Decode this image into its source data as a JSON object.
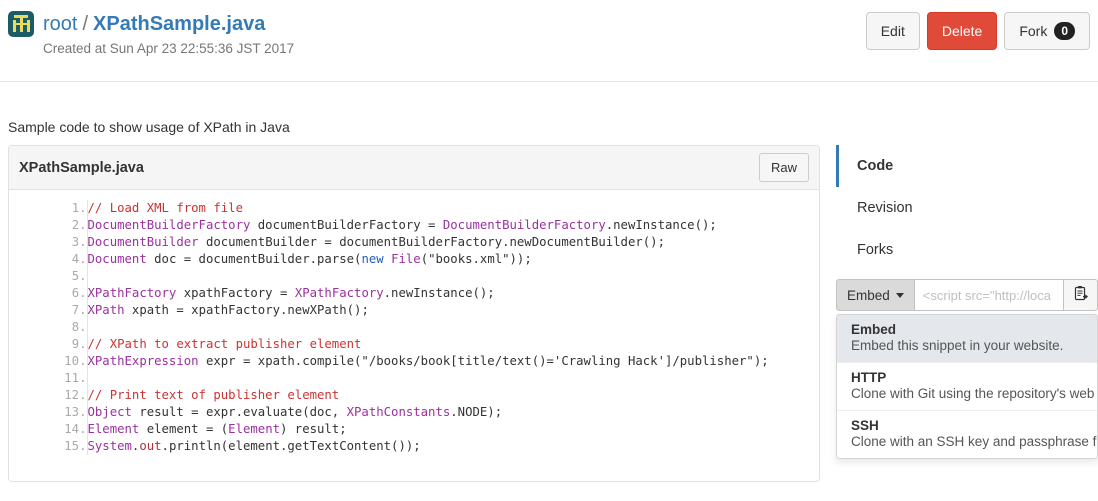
{
  "header": {
    "owner": "root",
    "separator": "/",
    "filename": "XPathSample.java",
    "created_at": "Created at Sun Apr 23 22:55:36 JST 2017",
    "avatar_icon": "identicon-avatar",
    "actions": {
      "edit_label": "Edit",
      "delete_label": "Delete",
      "fork_label": "Fork",
      "fork_count": "0"
    }
  },
  "main": {
    "description": "Sample code to show usage of XPath in Java",
    "code_panel": {
      "filename": "XPathSample.java",
      "raw_label": "Raw",
      "language": "java",
      "lines": [
        {
          "n": "1.",
          "tokens": [
            {
              "t": "// Load XML from file",
              "c": "c-com"
            }
          ]
        },
        {
          "n": "2.",
          "tokens": [
            {
              "t": "DocumentBuilderFactory",
              "c": "c-type"
            },
            {
              "t": " documentBuilderFactory = ",
              "c": "c-pln"
            },
            {
              "t": "DocumentBuilderFactory",
              "c": "c-type"
            },
            {
              "t": ".newInstance();",
              "c": "c-pln"
            }
          ]
        },
        {
          "n": "3.",
          "tokens": [
            {
              "t": "DocumentBuilder",
              "c": "c-type"
            },
            {
              "t": " documentBuilder = documentBuilderFactory.newDocumentBuilder();",
              "c": "c-pln"
            }
          ]
        },
        {
          "n": "4.",
          "tokens": [
            {
              "t": "Document",
              "c": "c-type"
            },
            {
              "t": " doc = documentBuilder.parse(",
              "c": "c-pln"
            },
            {
              "t": "new",
              "c": "c-kw"
            },
            {
              "t": " ",
              "c": "c-pln"
            },
            {
              "t": "File",
              "c": "c-type"
            },
            {
              "t": "(\"books.xml\"));",
              "c": "c-pln"
            }
          ]
        },
        {
          "n": "5.",
          "tokens": [
            {
              "t": "",
              "c": "c-pln"
            }
          ]
        },
        {
          "n": "6.",
          "tokens": [
            {
              "t": "XPathFactory",
              "c": "c-type"
            },
            {
              "t": " xpathFactory = ",
              "c": "c-pln"
            },
            {
              "t": "XPathFactory",
              "c": "c-type"
            },
            {
              "t": ".newInstance();",
              "c": "c-pln"
            }
          ]
        },
        {
          "n": "7.",
          "tokens": [
            {
              "t": "XPath",
              "c": "c-type"
            },
            {
              "t": " xpath = xpathFactory.newXPath();",
              "c": "c-pln"
            }
          ]
        },
        {
          "n": "8.",
          "tokens": [
            {
              "t": "",
              "c": "c-pln"
            }
          ]
        },
        {
          "n": "9.",
          "tokens": [
            {
              "t": "// XPath to extract publisher element",
              "c": "c-com"
            }
          ]
        },
        {
          "n": "10.",
          "tokens": [
            {
              "t": "XPathExpression",
              "c": "c-type"
            },
            {
              "t": " expr = xpath.compile(\"/books/book[title/text()='Crawling Hack']/publisher\");",
              "c": "c-pln"
            }
          ]
        },
        {
          "n": "11.",
          "tokens": [
            {
              "t": "",
              "c": "c-pln"
            }
          ]
        },
        {
          "n": "12.",
          "tokens": [
            {
              "t": "// Print text of publisher element",
              "c": "c-com"
            }
          ]
        },
        {
          "n": "13.",
          "tokens": [
            {
              "t": "Object",
              "c": "c-type"
            },
            {
              "t": " result = expr.evaluate(doc, ",
              "c": "c-pln"
            },
            {
              "t": "XPathConstants",
              "c": "c-type"
            },
            {
              "t": ".NODE);",
              "c": "c-pln"
            }
          ]
        },
        {
          "n": "14.",
          "tokens": [
            {
              "t": "Element",
              "c": "c-type"
            },
            {
              "t": " element = (",
              "c": "c-pln"
            },
            {
              "t": "Element",
              "c": "c-type"
            },
            {
              "t": ") result;",
              "c": "c-pln"
            }
          ]
        },
        {
          "n": "15.",
          "tokens": [
            {
              "t": "System",
              "c": "c-type"
            },
            {
              "t": ".",
              "c": "c-pln"
            },
            {
              "t": "out",
              "c": "c-fld"
            },
            {
              "t": ".println(element.getTextContent());",
              "c": "c-pln"
            }
          ]
        }
      ]
    }
  },
  "sidebar": {
    "nav": [
      {
        "label": "Code",
        "active": true
      },
      {
        "label": "Revision",
        "active": false
      },
      {
        "label": "Forks",
        "active": false
      }
    ],
    "embed": {
      "button_label": "Embed",
      "caret_icon": "caret-down-icon",
      "input_placeholder": "<script src=\"http://loca",
      "input_value": "",
      "copy_icon": "clipboard-copy-icon"
    },
    "dropdown": [
      {
        "title": "Embed",
        "desc": "Embed this snippet in your website.",
        "active": true
      },
      {
        "title": "HTTP",
        "desc": "Clone with Git using the repository's web",
        "active": false
      },
      {
        "title": "SSH",
        "desc": "Clone with an SSH key and passphrase f",
        "active": false
      }
    ]
  },
  "colors": {
    "link": "#337ab7",
    "danger": "#e04b39",
    "accent": "#337ab7",
    "avatar_bg": "#1b5c68",
    "avatar_fg": "#ecdc5a",
    "comment": "#cc3333",
    "type": "#9b30a0",
    "keyword": "#2060c0"
  }
}
